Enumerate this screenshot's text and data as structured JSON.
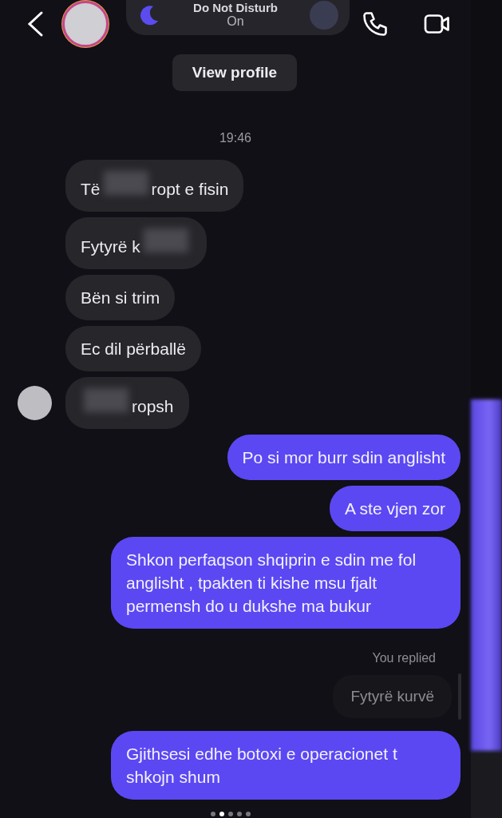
{
  "header": {
    "banner": {
      "title": "Do Not Disturb",
      "status": "On"
    },
    "view_profile": "View profile"
  },
  "time": "19:46",
  "messages": [
    {
      "kind": "incoming",
      "avatar": false,
      "parts": [
        {
          "kind": "text",
          "text": "Të"
        },
        {
          "kind": "blur"
        },
        {
          "kind": "text",
          "text": "ropt e fisin"
        }
      ]
    },
    {
      "kind": "incoming",
      "avatar": false,
      "parts": [
        {
          "kind": "text",
          "text": "Fytyrë k"
        },
        {
          "kind": "blur"
        }
      ]
    },
    {
      "kind": "incoming",
      "avatar": false,
      "parts": [
        {
          "kind": "text",
          "text": "Bën si trim"
        }
      ]
    },
    {
      "kind": "incoming",
      "avatar": false,
      "parts": [
        {
          "kind": "text",
          "text": "Ec dil përballë"
        }
      ]
    },
    {
      "kind": "incoming",
      "avatar": true,
      "parts": [
        {
          "kind": "blur"
        },
        {
          "kind": "text",
          "text": "ropsh"
        }
      ]
    },
    {
      "kind": "outgoing",
      "parts": [
        {
          "kind": "text",
          "text": "Po si mor burr sdin anglisht"
        }
      ]
    },
    {
      "kind": "outgoing",
      "parts": [
        {
          "kind": "text",
          "text": "A ste vjen zor"
        }
      ]
    },
    {
      "kind": "outgoing",
      "parts": [
        {
          "kind": "text",
          "text": "Shkon perfaqson shqiprin e sdin me fol anglisht , tpakten ti kishe msu fjalt permensh do u dukshe ma bukur"
        }
      ]
    }
  ],
  "reply": {
    "label": "You replied",
    "quote": "Fytyrë kurvë",
    "parts": [
      {
        "kind": "text",
        "text": "Gjithsesi edhe botoxi e operacionet t shkojn shum"
      }
    ]
  },
  "pager": [
    {
      "selected": false
    },
    {
      "selected": true
    },
    {
      "selected": false
    },
    {
      "selected": false
    },
    {
      "selected": false
    }
  ]
}
